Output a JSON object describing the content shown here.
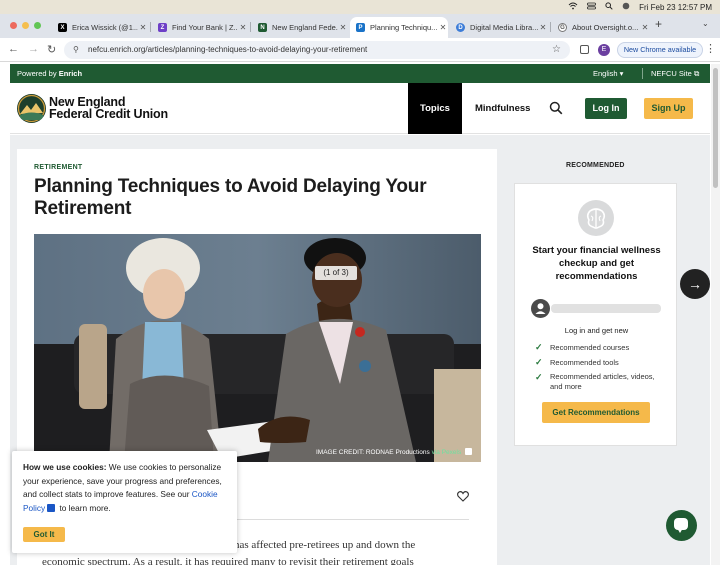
{
  "mac_menubar": {
    "datetime": "Fri Feb 23  12:57 PM"
  },
  "tabs": [
    {
      "label": "Erica Wissick (@1...",
      "favicon": "X",
      "color": "#000000",
      "active": false
    },
    {
      "label": "Find Your Bank | Z...",
      "favicon": "Z",
      "color": "#6d3fc7",
      "active": false
    },
    {
      "label": "New England Fede...",
      "favicon": "N",
      "color": "#1f5a32",
      "active": false
    },
    {
      "label": "Planning Techniqu...",
      "favicon": "P",
      "color": "#1a73c8",
      "active": true
    },
    {
      "label": "Digital Media Libra...",
      "favicon": "D",
      "color": "#3d7dd8",
      "active": false
    },
    {
      "label": "About Oversight.o...",
      "favicon": "G",
      "color": "#555555",
      "active": false
    }
  ],
  "address": {
    "url": "nefcu.enrich.org/articles/planning-techniques-to-avoid-delaying-your-retirement",
    "profile_initial": "E",
    "new_chrome": "New Chrome available"
  },
  "greenbar": {
    "powered_prefix": "Powered by ",
    "powered_brand": "Enrich",
    "language": "English ▾",
    "site_link": "NEFCU Site"
  },
  "header": {
    "logo_line1": "New England",
    "logo_line2": "Federal Credit Union",
    "nav_topics": "Topics",
    "nav_mindfulness": "Mindfulness",
    "login": "Log In",
    "signup": "Sign Up"
  },
  "article": {
    "category": "RETIREMENT",
    "title": "Planning Techniques to Avoid Delaying Your Retirement",
    "image_counter": "(1 of 3)",
    "credit_prefix": "IMAGE CREDIT: RODNAE Productions",
    "credit_via": " via Pexels",
    "body_line1": "has affected pre-retirees up and down the",
    "body_line2": "economic spectrum. As a result, it has required many to revisit their retirement goals"
  },
  "recommended": {
    "label": "RECOMMENDED",
    "title": "Start your financial wellness checkup and get recommendations",
    "login_prompt": "Log in and get new",
    "items": [
      "Recommended courses",
      "Recommended tools",
      "Recommended articles, videos, and more"
    ],
    "button": "Get Recommendations"
  },
  "cookie": {
    "heading": "How we use cookies:",
    "text": " We use cookies to personalize your experience, save your progress and preferences, and collect stats to improve features. See our ",
    "link": "Cookie Policy",
    "suffix": " to learn more.",
    "button": "Got It"
  },
  "colors": {
    "brand_green": "#1f5a32",
    "brand_gold": "#f5b94a"
  }
}
